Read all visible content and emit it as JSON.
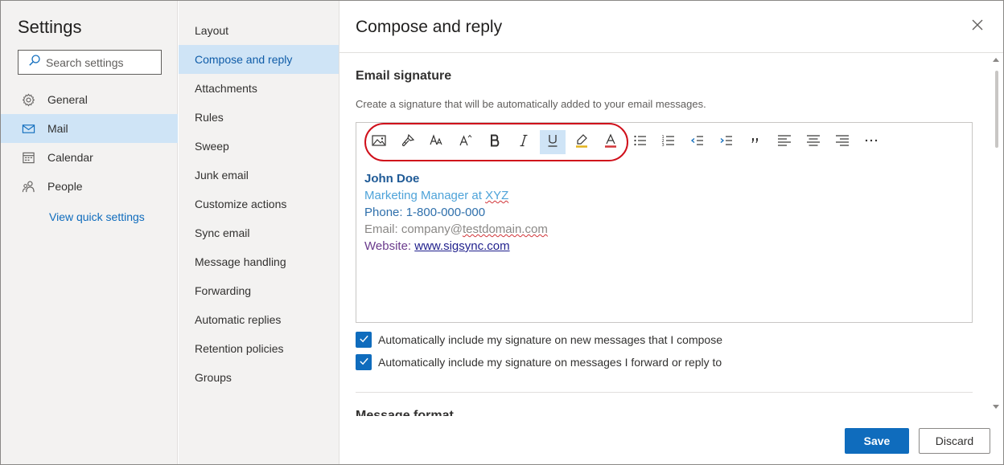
{
  "left": {
    "title": "Settings",
    "search_placeholder": "Search settings",
    "categories": [
      {
        "label": "General",
        "icon": "gear-icon"
      },
      {
        "label": "Mail",
        "icon": "mail-icon"
      },
      {
        "label": "Calendar",
        "icon": "calendar-icon"
      },
      {
        "label": "People",
        "icon": "people-icon"
      }
    ],
    "active_category": "Mail",
    "view_quick_settings": "View quick settings"
  },
  "middle": {
    "items": [
      "Layout",
      "Compose and reply",
      "Attachments",
      "Rules",
      "Sweep",
      "Junk email",
      "Customize actions",
      "Sync email",
      "Message handling",
      "Forwarding",
      "Automatic replies",
      "Retention policies",
      "Groups"
    ],
    "active_item": "Compose and reply"
  },
  "right": {
    "title": "Compose and reply",
    "section_title": "Email signature",
    "section_desc": "Create a signature that will be automatically added to your email messages.",
    "toolbar": [
      "insert-picture-icon",
      "format-painter-icon",
      "font-icon",
      "font-size-icon",
      "bold-icon",
      "italic-icon",
      "underline-icon",
      "highlight-icon",
      "font-color-icon",
      "bullets-icon",
      "numbering-icon",
      "decrease-indent-icon",
      "increase-indent-icon",
      "quote-icon",
      "align-left-icon",
      "align-center-icon",
      "align-right-icon",
      "more-options-icon"
    ],
    "toolbar_active": "underline-icon",
    "signature": {
      "name": "John Doe",
      "role_prefix": "Marketing Manager at ",
      "role_company": "XYZ",
      "phone": "Phone: 1-800-000-000",
      "email_prefix": "Email: company@",
      "email_domain": "testdomain.com",
      "web_prefix": "Website: ",
      "web_link": "www.sigsync.com"
    },
    "checkboxes": [
      {
        "label": "Automatically include my signature on new messages that I compose",
        "checked": true
      },
      {
        "label": "Automatically include my signature on messages I forward or reply to",
        "checked": true
      }
    ],
    "next_section_title": "Message format",
    "save_label": "Save",
    "discard_label": "Discard"
  },
  "colors": {
    "accent": "#0f6cbd",
    "selected_bg": "#cfe4f6",
    "annotation_ring": "#d0101b"
  }
}
